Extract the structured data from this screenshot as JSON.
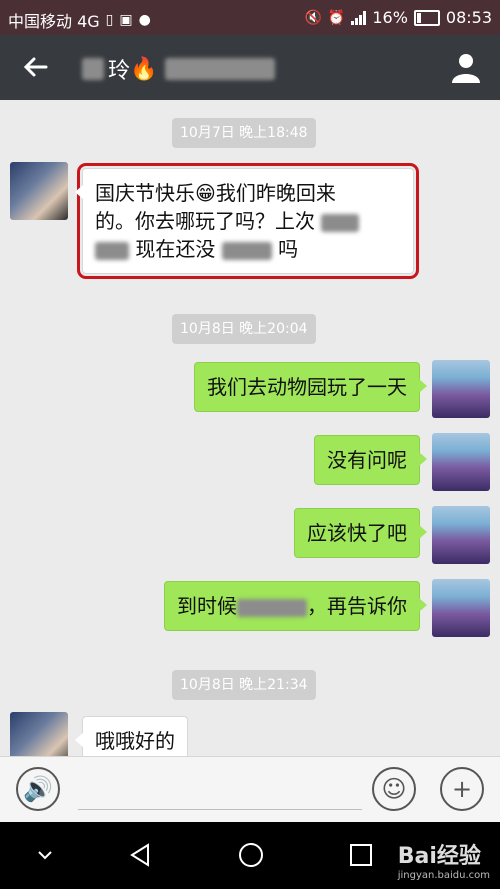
{
  "status_bar": {
    "carrier": "中国移动 4G",
    "battery": "16%",
    "time": "08:53",
    "network": "4G"
  },
  "header": {
    "back_icon": "back-arrow-icon",
    "contact_name": "玲",
    "contact_emoji": "🔥",
    "profile_icon": "person-icon"
  },
  "messages": [
    {
      "type": "timestamp",
      "text": "10月7日 晚上18:48"
    },
    {
      "type": "incoming",
      "lines": [
        "国庆节快乐😁我们昨晚回来",
        "的。你去哪玩了吗？上次",
        "现在还没",
        "吗"
      ]
    },
    {
      "type": "timestamp",
      "text": "10月8日 晚上20:04"
    },
    {
      "type": "outgoing",
      "text": "我们去动物园玩了一天"
    },
    {
      "type": "outgoing",
      "text": "没有问呢"
    },
    {
      "type": "outgoing",
      "text": "应该快了吧"
    },
    {
      "type": "outgoing",
      "text_before": "到时候",
      "text_after": "，再告诉你"
    },
    {
      "type": "timestamp",
      "text": "10月8日 晚上21:34"
    },
    {
      "type": "incoming",
      "text": "哦哦好的"
    }
  ],
  "input_bar": {
    "voice_icon": "voice-icon",
    "emoji_icon": "emoji-icon",
    "add_icon": "plus-icon"
  },
  "nav_bar": {
    "watermark": "Bai经验",
    "watermark_url": "jingyan.baidu.com"
  },
  "colors": {
    "status_bar": "#4a2f35",
    "title_bar": "#373b3f",
    "chat_bg": "#ebebeb",
    "outgoing_bubble": "#9fe658",
    "highlight": "#c8161d"
  }
}
